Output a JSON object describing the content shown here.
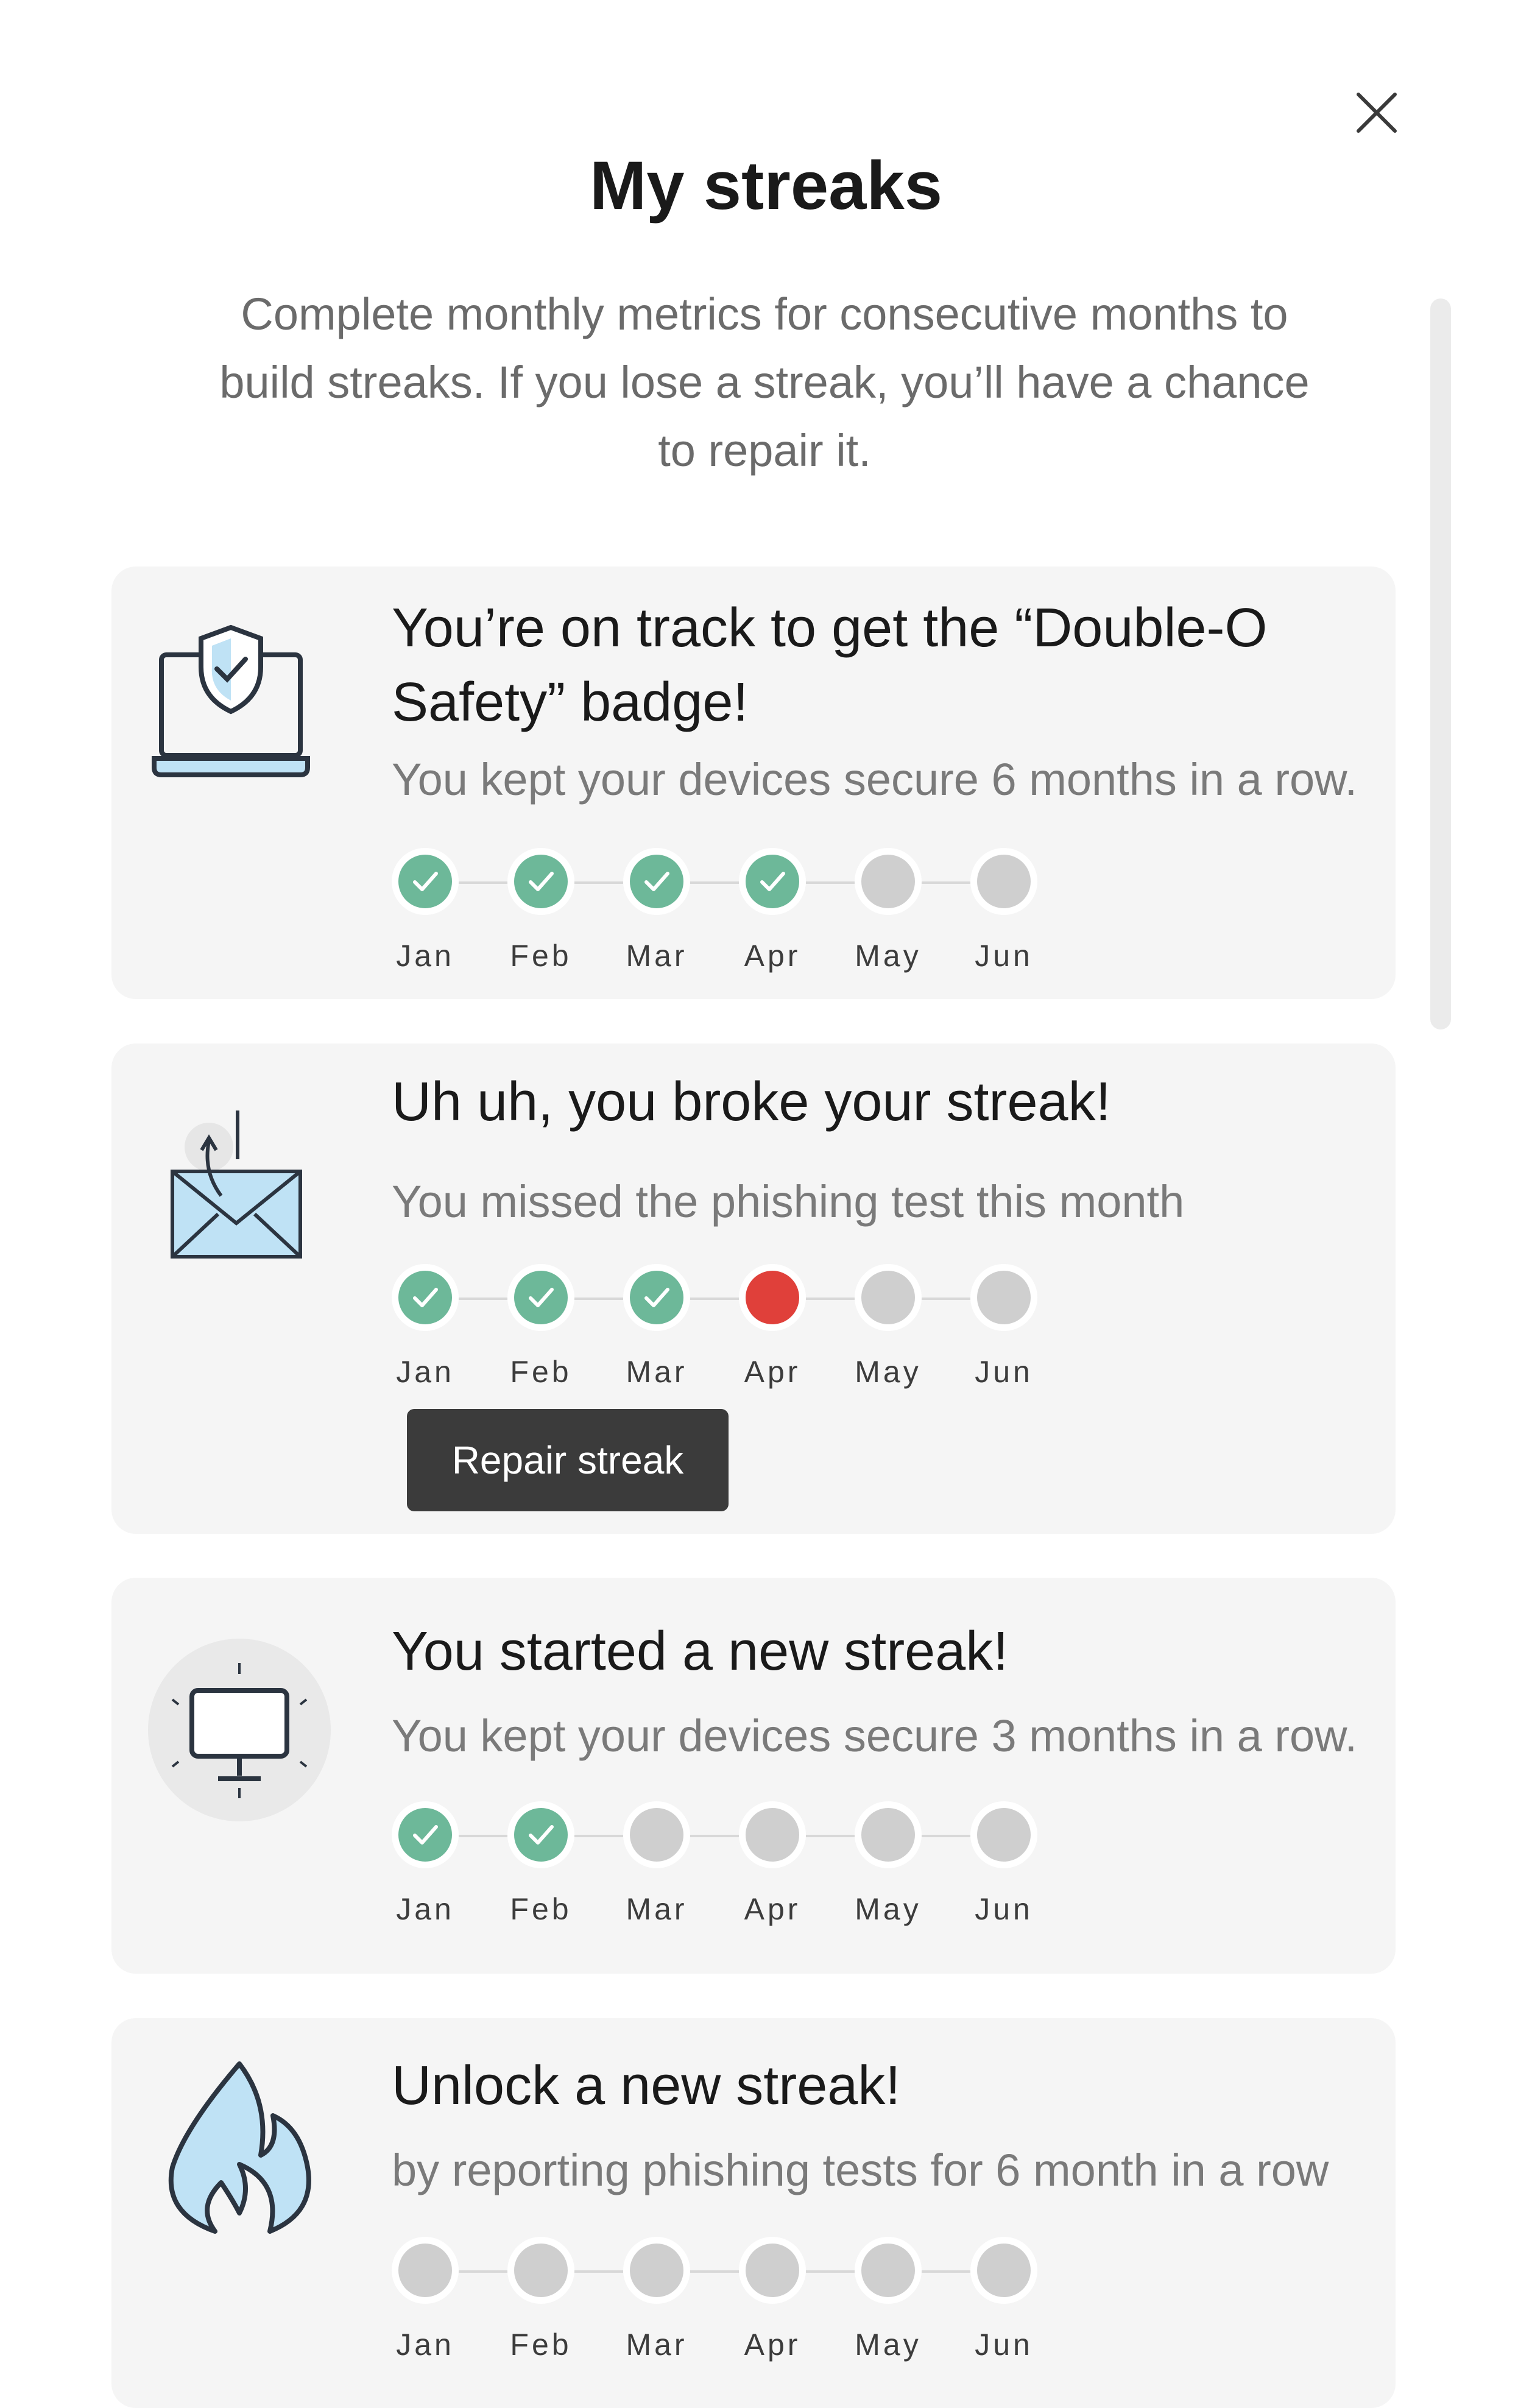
{
  "dialog": {
    "title": "My streaks",
    "intro": "Complete monthly metrics for consecutive months to build streaks. If you lose a streak, you’ll have a chance to repair it."
  },
  "cards": [
    {
      "icon": "laptop-shield-icon",
      "title": "You’re on track to get the “Double-O Safety” badge!",
      "subtitle": "You kept your devices secure 6 months in a row.",
      "months": [
        {
          "label": "Jan",
          "status": "done"
        },
        {
          "label": "Feb",
          "status": "done"
        },
        {
          "label": "Mar",
          "status": "done"
        },
        {
          "label": "Apr",
          "status": "done"
        },
        {
          "label": "May",
          "status": "todo"
        },
        {
          "label": "Jun",
          "status": "todo"
        }
      ]
    },
    {
      "icon": "envelope-icon",
      "title": "Uh uh, you broke your streak!",
      "subtitle": "You missed the phishing test this month",
      "button": "Repair streak",
      "months": [
        {
          "label": "Jan",
          "status": "done"
        },
        {
          "label": "Feb",
          "status": "done"
        },
        {
          "label": "Mar",
          "status": "done"
        },
        {
          "label": "Apr",
          "status": "missed"
        },
        {
          "label": "May",
          "status": "todo"
        },
        {
          "label": "Jun",
          "status": "todo"
        }
      ]
    },
    {
      "icon": "monitor-icon",
      "title": "You started a new streak!",
      "subtitle": "You kept your devices secure 3 months in a row.",
      "months": [
        {
          "label": "Jan",
          "status": "done"
        },
        {
          "label": "Feb",
          "status": "done"
        },
        {
          "label": "Mar",
          "status": "todo"
        },
        {
          "label": "Apr",
          "status": "todo"
        },
        {
          "label": "May",
          "status": "todo"
        },
        {
          "label": "Jun",
          "status": "todo"
        }
      ]
    },
    {
      "icon": "flame-icon",
      "title": "Unlock a new streak!",
      "subtitle": "by reporting phishing tests for 6 month in a row",
      "months": [
        {
          "label": "Jan",
          "status": "todo"
        },
        {
          "label": "Feb",
          "status": "todo"
        },
        {
          "label": "Mar",
          "status": "todo"
        },
        {
          "label": "Apr",
          "status": "todo"
        },
        {
          "label": "May",
          "status": "todo"
        },
        {
          "label": "Jun",
          "status": "todo"
        }
      ]
    }
  ],
  "colors": {
    "done": "#6db899",
    "missed": "#e0403a",
    "todo": "#cfcfcf",
    "button": "#3b3b3b"
  }
}
